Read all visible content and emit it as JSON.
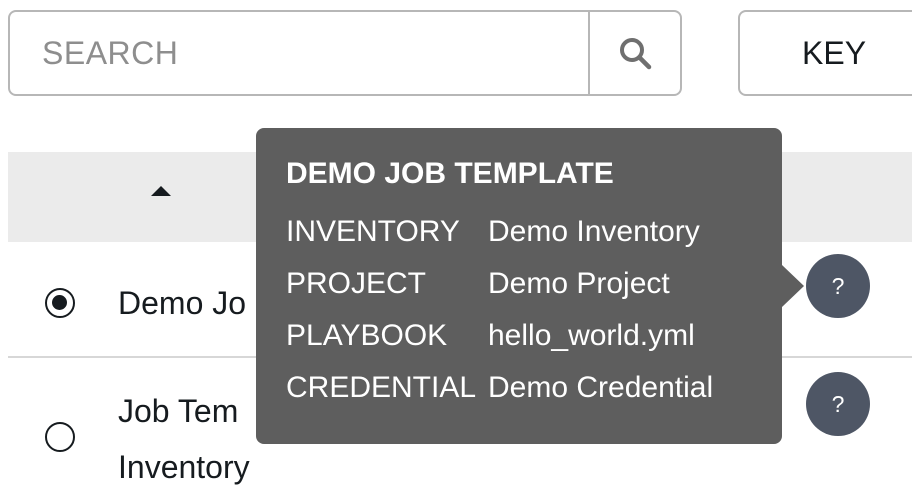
{
  "search": {
    "placeholder": "SEARCH",
    "icon": "search-icon"
  },
  "key_button": {
    "label": "KEY"
  },
  "table": {
    "sort_icon": "sort-up-icon",
    "rows": [
      {
        "name_line1": "Demo Jo",
        "selected": true,
        "help_label": "?"
      },
      {
        "name_line1": "Job Tem",
        "name_line2": "Inventory",
        "selected": false,
        "help_label": "?"
      }
    ]
  },
  "popover": {
    "title": "DEMO JOB TEMPLATE",
    "fields": [
      {
        "label": "INVENTORY",
        "value": "Demo Inventory"
      },
      {
        "label": "PROJECT",
        "value": "Demo Project"
      },
      {
        "label": "PLAYBOOK",
        "value": "hello_world.yml"
      },
      {
        "label": "CREDENTIAL",
        "value": "Demo Credential"
      }
    ]
  },
  "colors": {
    "popover_bg": "#5e5e5e",
    "help_icon_bg": "#4e5665",
    "header_bg": "#ebebeb",
    "border": "#b7b7b7"
  }
}
